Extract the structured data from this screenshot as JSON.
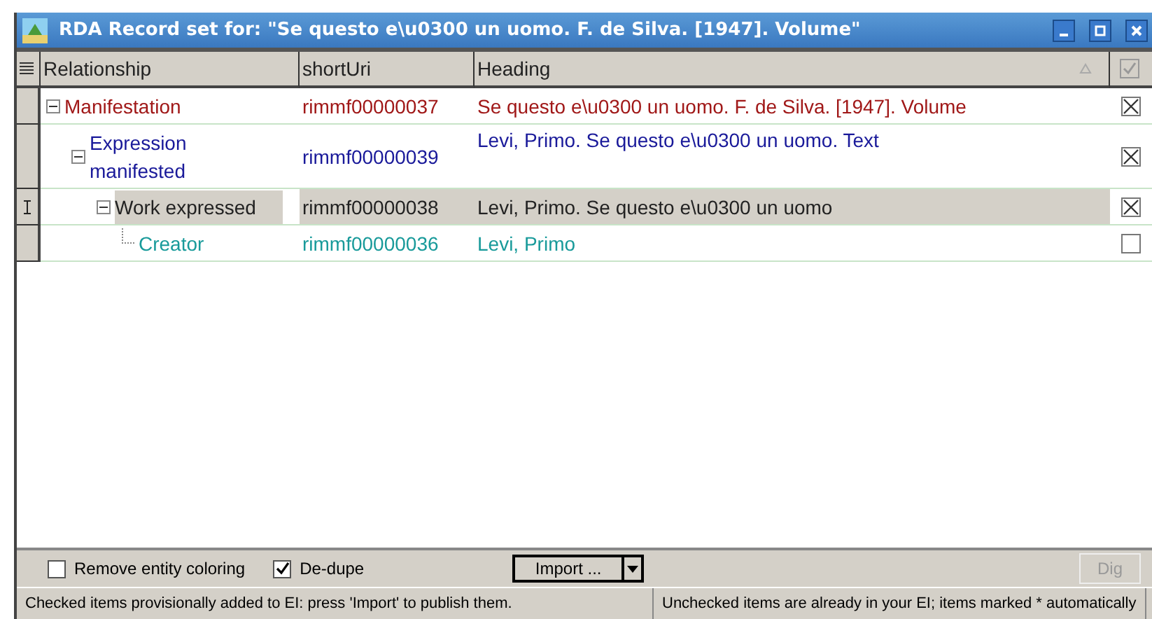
{
  "window": {
    "title": "RDA Record set for: \"Se questo e\\u0300 un uomo. F. de Silva. [1947]. Volume\""
  },
  "columns": [
    "Relationship",
    "shortUri",
    "Heading"
  ],
  "rows": [
    {
      "relationship": "Manifestation",
      "short_uri": "rimmf00000037",
      "heading": "Se questo e\\u0300 un uomo. F. de Silva. [1947]. Volume",
      "color": "#a01818",
      "expanded": true,
      "selected": false,
      "checked": true,
      "children": [
        {
          "relationship": "Expression manifested",
          "short_uri": "rimmf00000039",
          "heading": "Levi, Primo. Se questo e\\u0300 un uomo. Text",
          "color": "#1a1a9a",
          "expanded": true,
          "selected": false,
          "checked": true,
          "children": [
            {
              "relationship": "Work expressed",
              "short_uri": "rimmf00000038",
              "heading": "Levi, Primo. Se questo e\\u0300 un uomo",
              "color": "#222222",
              "expanded": true,
              "selected": true,
              "checked": true,
              "children": [
                {
                  "relationship": "Creator",
                  "short_uri": "rimmf00000036",
                  "heading": "Levi, Primo",
                  "color": "#189a9a",
                  "selected": false,
                  "checked": false
                }
              ]
            }
          ]
        }
      ]
    }
  ],
  "options": [
    {
      "label": "Remove entity coloring",
      "checked": false
    },
    {
      "label": "De-dupe",
      "checked": true
    }
  ],
  "import_button": "Import ...",
  "dig_button": {
    "label": "Dig",
    "disabled": true
  },
  "status_bar": [
    "Checked items provisionally added to EI: press 'Import' to publish them.",
    "Unchecked items are already in your EI; items marked * automatically"
  ]
}
